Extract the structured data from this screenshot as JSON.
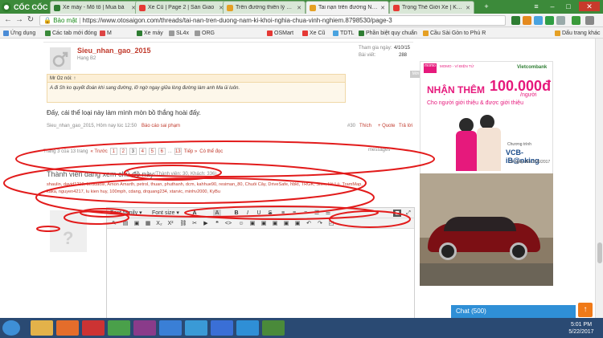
{
  "browser": {
    "logo": "CỐC CỐC",
    "tabs": [
      {
        "title": "Xe máy - Mô tô | Mua bá",
        "color": "#2e7d32"
      },
      {
        "title": "Xe Cũ | Page 2 | Sàn Giao",
        "color": "#e53935"
      },
      {
        "title": "Trên đường thiên lý và cả",
        "color": "#e5a024"
      },
      {
        "title": "Tai nạn trên đường Nam t",
        "color": "#e5a024"
      },
      {
        "title": "Trọng Thế Giới Xe | Khác",
        "color": "#e53935"
      }
    ],
    "url_secure": "Bảo mật",
    "url": "https://www.otosaigon.com/threads/tai-nan-tren-duong-nam-ki-khoi-nghia-chua-vinh-nghiem.8798530/page-3",
    "bookmarks": [
      "Ứng dụng",
      "Các tab mới đóng",
      "M",
      "Xe máy",
      "SL4x",
      "ORG",
      "OSMart",
      "Xe Cũ",
      "TDTL",
      "Phần biệt quy chuẩn",
      "Cầu Sài Gòn to Phú R"
    ],
    "bookmarks_right": "Dấu trang khác"
  },
  "post": {
    "username": "Sieu_nhan_gao_2015",
    "rank": "Hạng B2",
    "joined_label": "Tham gia ngày:",
    "joined_value": "4/10/15",
    "posts_label": "Bài viết:",
    "posts_value": "288",
    "quote_head": "Mr Oz nói: ↑",
    "quote_text": "A đi Sh ko quyết đoán khi sang đường, lỡ ngờ ngay giữa lòng đường làm anh Ma ủi luôn.",
    "body": "Đấy, cái thể loại này làm mình mòn bồ thắng hoài đấy.",
    "footer_meta": "Sieu_nhan_gao_2015, Hôm nay lúc 12:50",
    "report": "Báo cáo sai phạm",
    "post_no": "#30",
    "like": "Thích",
    "quote_btn": "+ Quote",
    "reply": "Trả lời",
    "side_tag": "Mới"
  },
  "pagination": {
    "label": "Trang 3 của 13 trang",
    "prev": "« Trước",
    "pages": [
      "1",
      "2",
      "3",
      "4",
      "5",
      "6",
      "...",
      "13"
    ],
    "next": "Tiếp »",
    "unread": "Có thể đọc",
    "messages": "messages"
  },
  "viewers": {
    "title": "Thành viên đang xem chủ đề này",
    "counts": "(Thành viên: 30, Khách: 336)",
    "names_line1": "shaulin, david1210, beudaosi, Amon Amarth, petrol, thuan, phuthanh, dcm, kahhue90, resiman_80, Chuối Cây, DriveSafe, hbkt, TRGK, Stvn, Hồ Lù, TramMap,",
    "names_line2": "kaka, nguyen4217, lu kien huy, 100mph, cdang, drquang234, xtarvic, minhv2000, KyBu"
  },
  "editor": {
    "font_family": "Font family",
    "font_size": "Font size"
  },
  "ad": {
    "brand": "momo",
    "brand_sub": "MOMO - VÍ ĐIỆN TỬ",
    "bank": "Vietcombank",
    "headline": "NHẬN THÊM",
    "amount": "100.000đ",
    "per": "/người",
    "sub": "Cho người giới thiệu & được giới thiệu",
    "program": "Chương trình",
    "program_name": "VCB-iB@nking",
    "dates": "10 ngày đến 31/6/2017"
  },
  "chat": {
    "label": "Chat (500)"
  },
  "taskbar": {
    "time": "5:01 PM",
    "date": "5/22/2017"
  },
  "colors": {
    "accent": "#c0392b",
    "tab_strip": "#3c8a3a",
    "taskbar": "#2a4a73",
    "chat": "#2f8fd6",
    "ad_pink": "#e6197c"
  }
}
